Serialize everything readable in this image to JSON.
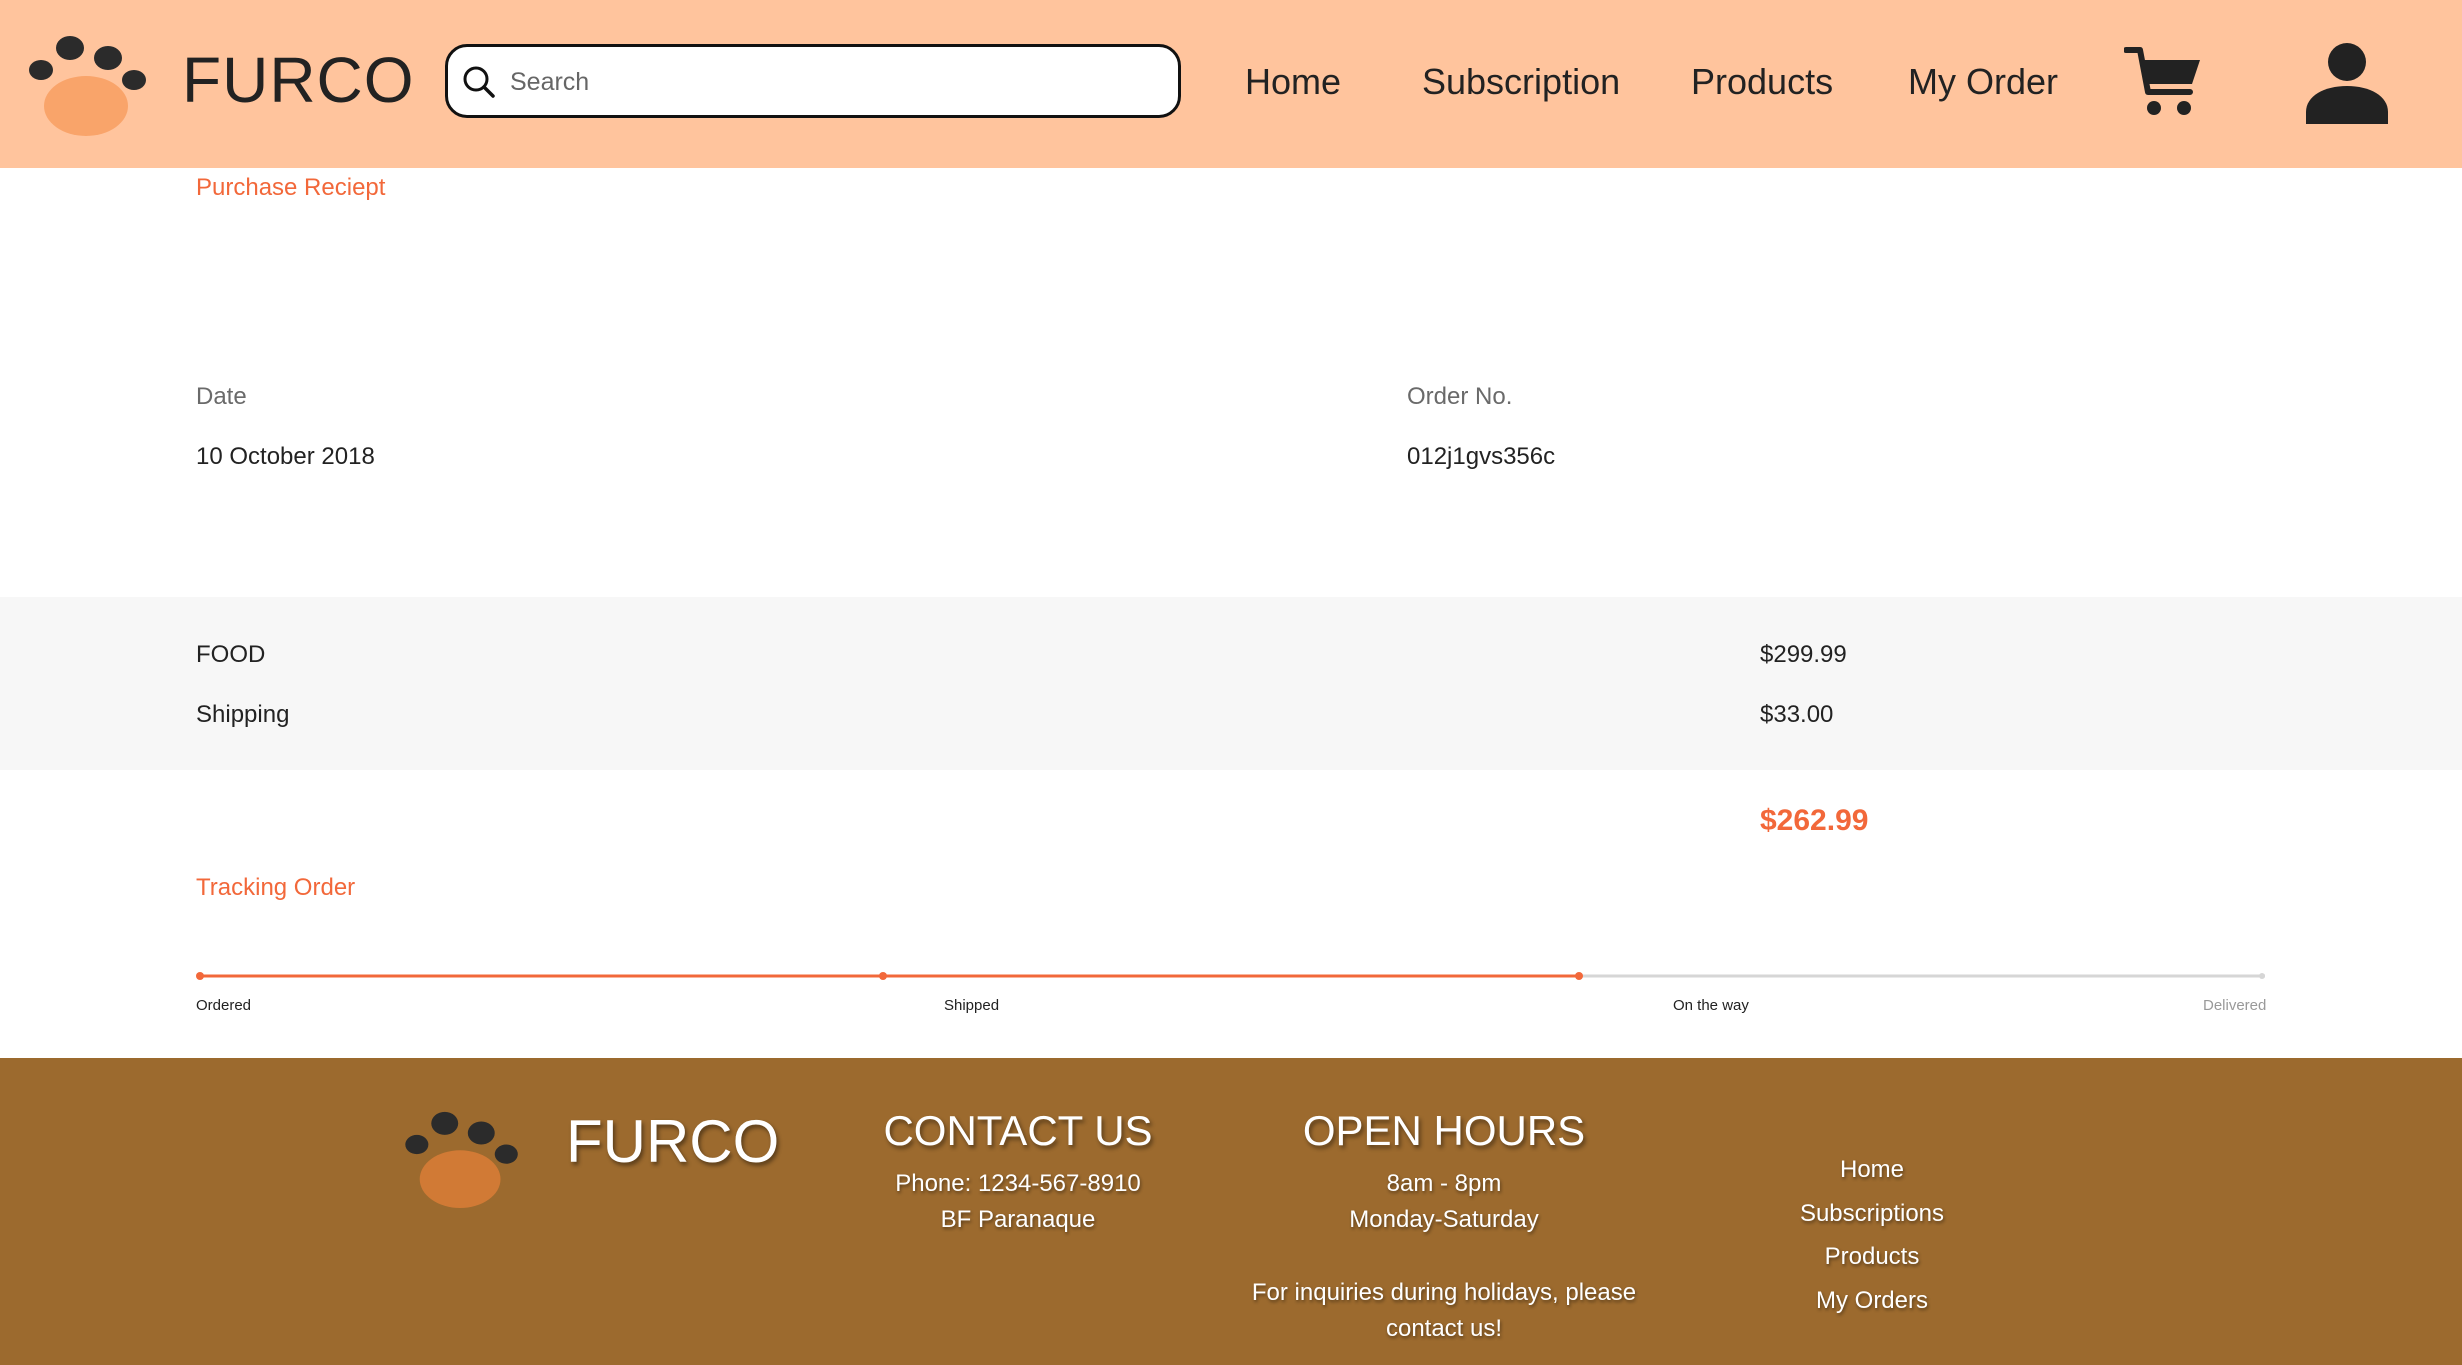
{
  "header": {
    "brand": "FURCO",
    "search": {
      "placeholder": "Search",
      "value": ""
    },
    "nav": [
      "Home",
      "Subscription",
      "Products",
      "My Order"
    ],
    "icons": [
      "paw-logo-icon",
      "search-icon",
      "cart-icon",
      "user-icon"
    ]
  },
  "receipt": {
    "title": "Purchase Reciept",
    "date_label": "Date",
    "date_value": "10 October 2018",
    "order_label": "Order No.",
    "order_value": "012j1gvs356c",
    "items": [
      {
        "name": "FOOD",
        "price": "$299.99"
      },
      {
        "name": "Shipping",
        "price": "$33.00"
      }
    ],
    "total": "$262.99"
  },
  "tracking": {
    "title": "Tracking Order",
    "steps": [
      {
        "label": "Ordered",
        "done": true
      },
      {
        "label": "Shipped",
        "done": true
      },
      {
        "label": "On the way",
        "done": true
      },
      {
        "label": "Delivered",
        "done": false
      }
    ]
  },
  "footer": {
    "brand": "FURCO",
    "contact": {
      "title": "CONTACT US",
      "phone": "Phone: 1234-567-8910",
      "address": "BF Paranaque"
    },
    "hours": {
      "title": "OPEN HOURS",
      "time": "8am - 8pm",
      "days": "Monday-Saturday",
      "note_line1": "For inquiries during holidays, please",
      "note_line2": "contact us!"
    },
    "links": [
      "Home",
      "Subscriptions",
      "Products",
      "My Orders"
    ]
  },
  "colors": {
    "header_bg": "#ffc49d",
    "accent": "#f2683a",
    "footer_bg": "#9c6a2e",
    "band_bg": "#f7f7f7"
  }
}
